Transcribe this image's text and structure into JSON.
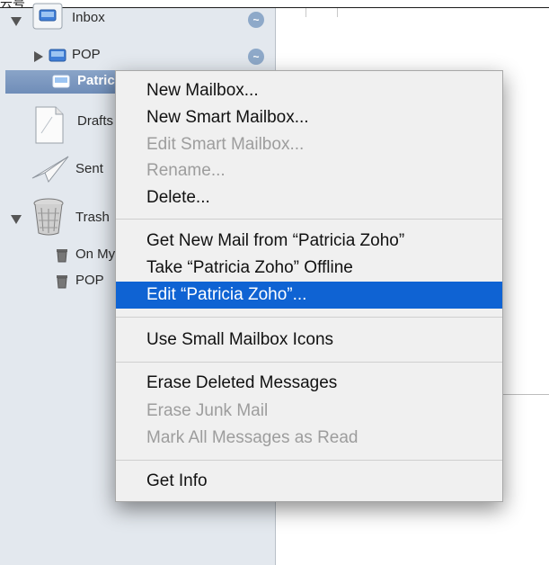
{
  "top_fragment": "云号",
  "sidebar": {
    "items": [
      {
        "label": "Inbox"
      },
      {
        "label": "POP"
      },
      {
        "label": "Patrici"
      },
      {
        "label": "Drafts"
      },
      {
        "label": "Sent"
      },
      {
        "label": "Trash"
      },
      {
        "label": "On My Mac"
      },
      {
        "label": "POP"
      }
    ]
  },
  "context_menu": {
    "items": [
      {
        "label": "New Mailbox..."
      },
      {
        "label": "New Smart Mailbox..."
      },
      {
        "label": "Edit Smart Mailbox..."
      },
      {
        "label": "Rename..."
      },
      {
        "label": "Delete..."
      },
      {
        "label": "Get New Mail from “Patricia Zoho”"
      },
      {
        "label": "Take “Patricia Zoho” Offline"
      },
      {
        "label": "Edit “Patricia Zoho”..."
      },
      {
        "label": "Use Small Mailbox Icons"
      },
      {
        "label": "Erase Deleted Messages"
      },
      {
        "label": "Erase Junk Mail"
      },
      {
        "label": "Mark All Messages as Read"
      },
      {
        "label": "Get Info"
      }
    ]
  },
  "colors": {
    "sidebar_bg": "#e3e8ee",
    "selection": "#0f63d3",
    "menu_bg": "#f0f0f0"
  }
}
